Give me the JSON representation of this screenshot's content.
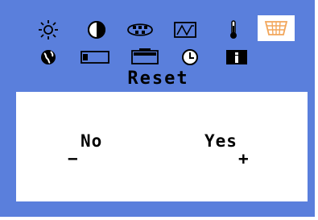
{
  "osd": {
    "menu_icons": [
      {
        "name": "brightness-icon",
        "selected": false
      },
      {
        "name": "contrast-icon",
        "selected": false
      },
      {
        "name": "image-setup-icon",
        "selected": false
      },
      {
        "name": "waveform-icon",
        "selected": false
      },
      {
        "name": "color-temperature-icon",
        "selected": false
      },
      {
        "name": "reset-options-icon",
        "selected": true
      },
      {
        "name": "language-globe-icon",
        "selected": false
      },
      {
        "name": "h-position-icon",
        "selected": false
      },
      {
        "name": "v-position-icon",
        "selected": false
      },
      {
        "name": "osd-timeout-icon",
        "selected": false
      },
      {
        "name": "information-icon",
        "selected": false
      }
    ],
    "title": "Reset",
    "options": {
      "no_label": "No",
      "no_symbol": "−",
      "yes_label": "Yes",
      "yes_symbol": "+"
    },
    "colors": {
      "background": "#5a7fdc",
      "panel": "#ffffff",
      "selected_icon_bg": "#ffffff",
      "selected_icon_fg": "#f2a65a"
    }
  }
}
